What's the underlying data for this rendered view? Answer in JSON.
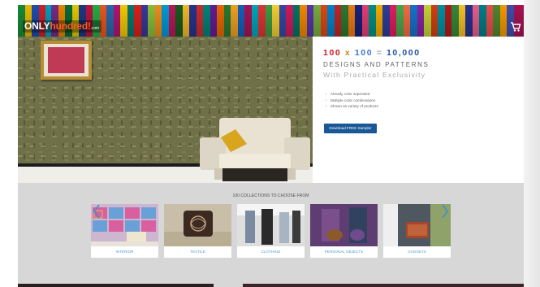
{
  "header": {
    "logo": {
      "part1": "ONLY",
      "part2": "hundred!",
      "part3": ".com"
    },
    "cart_icon": "cart-icon"
  },
  "hero": {
    "headline": {
      "a": "100",
      "x": "x",
      "b": "100",
      "eq": "=",
      "c": "10,000"
    },
    "subtitle1": "DESIGNS AND PATTERNS",
    "subtitle2": "With Practical Exclusivity",
    "features": [
      "Already color seperated",
      "Multiple color combinations",
      "Shown as variety of products"
    ],
    "download_label": "Download FREE Sampler"
  },
  "collections": {
    "title": "100 COLLECTIONS TO CHOOSE FROM",
    "items": [
      {
        "label": "INTERIOR"
      },
      {
        "label": "TEXTILE"
      },
      {
        "label": "CLOTHING"
      },
      {
        "label": "PERSONAL OBJECTS"
      },
      {
        "label": "GADGETS"
      }
    ],
    "prev_icon": "chevron-left-icon",
    "next_icon": "chevron-right-icon"
  },
  "colors": {
    "accent_blue": "#1a5796",
    "headline_red": "#d1181c",
    "headline_blue": "#1b4fa6",
    "caption_blue": "#4a9fd1"
  }
}
